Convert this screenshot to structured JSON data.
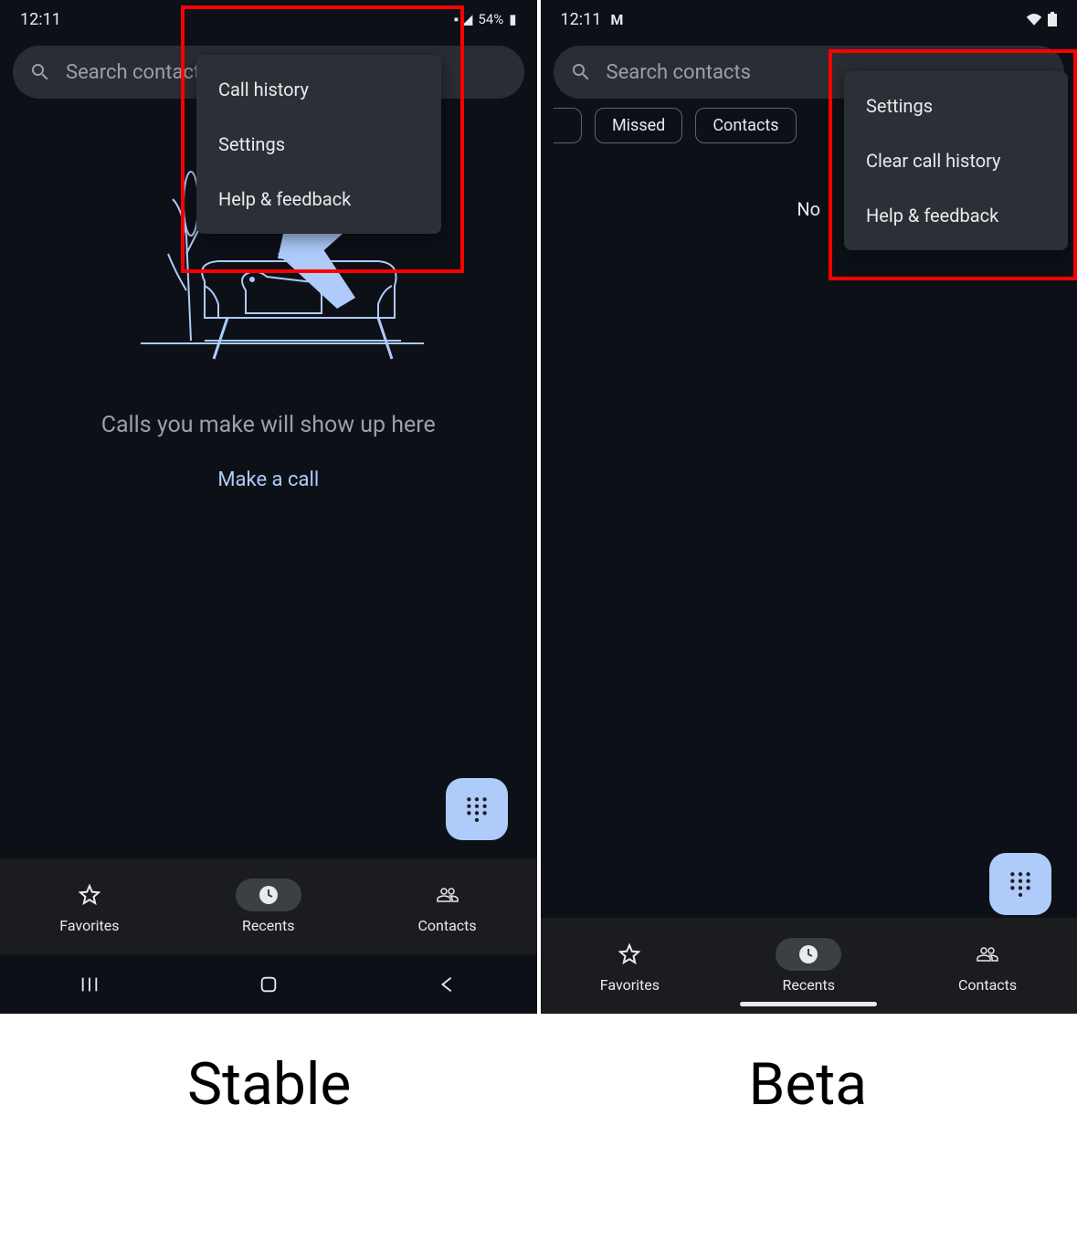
{
  "stable": {
    "status": {
      "time": "12:11",
      "battery_text": "54%"
    },
    "search_placeholder": "Search contacts",
    "menu": [
      "Call history",
      "Settings",
      "Help & feedback"
    ],
    "empty_text": "Calls you make will show up here",
    "make_call": "Make a call",
    "nav": [
      "Favorites",
      "Recents",
      "Contacts"
    ],
    "caption": "Stable"
  },
  "beta": {
    "status": {
      "time": "12:11"
    },
    "search_placeholder": "Search contacts",
    "chips": [
      "Missed",
      "Contacts"
    ],
    "menu": [
      "Settings",
      "Clear call history",
      "Help & feedback"
    ],
    "no_text": "No",
    "nav": [
      "Favorites",
      "Recents",
      "Contacts"
    ],
    "caption": "Beta"
  }
}
